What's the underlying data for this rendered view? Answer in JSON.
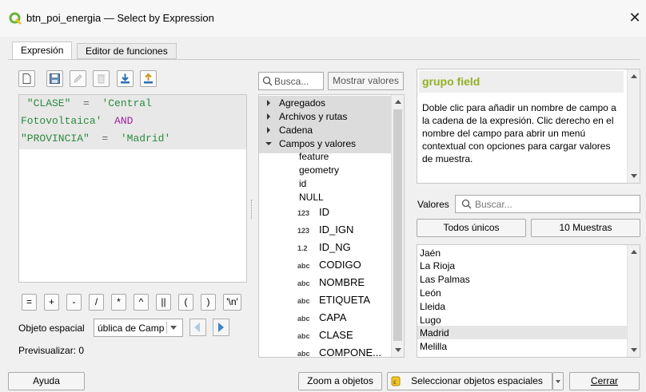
{
  "window": {
    "title": "btn_poi_energia — Select by Expression",
    "close": "✕",
    "icon": "qgis-icon",
    "brand_color": "#6bb33a"
  },
  "tabs": [
    {
      "label": "Expresión",
      "active": true
    },
    {
      "label": "Editor de funciones",
      "active": false
    }
  ],
  "toolbar": {
    "icons": [
      "new-file-icon",
      "save-icon",
      "edit-icon",
      "delete-icon",
      "import-icon",
      "export-icon"
    ]
  },
  "expression": {
    "line1": {
      "a": " \"CLASE\"",
      "b": "  =  ",
      "c": "'Central"
    },
    "line2": {
      "a": "Fotovoltaica'",
      "b": "  AND"
    },
    "line3": {
      "a": "\"PROVINCIA\"",
      "b": "  =  ",
      "c": "'Madrid'"
    }
  },
  "operators": [
    "=",
    "+",
    "-",
    "/",
    "*",
    "^",
    "||",
    "(",
    ")",
    "'\\n'"
  ],
  "feature": {
    "label": "Objeto espacial",
    "value": "ública de Campo"
  },
  "preview": {
    "label": "Previsualizar:",
    "value": "0"
  },
  "functions": {
    "search_placeholder": "Busca...",
    "show_values": "Mostrar valores",
    "groups": [
      {
        "label": "Agregados",
        "expanded": false
      },
      {
        "label": "Archivos y rutas",
        "expanded": false
      },
      {
        "label": "Cadena",
        "expanded": false
      },
      {
        "label": "Campos y valores",
        "expanded": true
      }
    ],
    "items": [
      {
        "type": "",
        "label": "feature"
      },
      {
        "type": "",
        "label": "geometry"
      },
      {
        "type": "",
        "label": "id"
      },
      {
        "type": "",
        "label": "NULL"
      },
      {
        "type": "123",
        "label": "ID"
      },
      {
        "type": "123",
        "label": "ID_IGN"
      },
      {
        "type": "1.2",
        "label": "ID_NG"
      },
      {
        "type": "abc",
        "label": "CODIGO"
      },
      {
        "type": "abc",
        "label": "NOMBRE"
      },
      {
        "type": "abc",
        "label": "ETIQUETA"
      },
      {
        "type": "abc",
        "label": "CAPA"
      },
      {
        "type": "abc",
        "label": "CLASE"
      },
      {
        "type": "abc",
        "label": "COMPONE..."
      }
    ]
  },
  "help": {
    "title": "grupo field",
    "body": "Doble clic para añadir un nombre de campo a la cadena de la expresión. Clic derecho en el nombre del campo para abrir un menú contextual con opciones para cargar valores de muestra.",
    "title_color": "#93b023"
  },
  "values": {
    "label": "Valores",
    "search_placeholder": "Buscar...",
    "all_unique": "Todos únicos",
    "samples": "10 Muestras",
    "items": [
      "Jaén",
      "La Rioja",
      "Las Palmas",
      "León",
      "Lleida",
      "Lugo",
      "Madrid",
      "Melilla"
    ],
    "selected": "Madrid"
  },
  "footer": {
    "help": "Ayuda",
    "zoom": "Zoom a objetos",
    "select": "Seleccionar objetos espaciales",
    "close": "Cerrar"
  }
}
